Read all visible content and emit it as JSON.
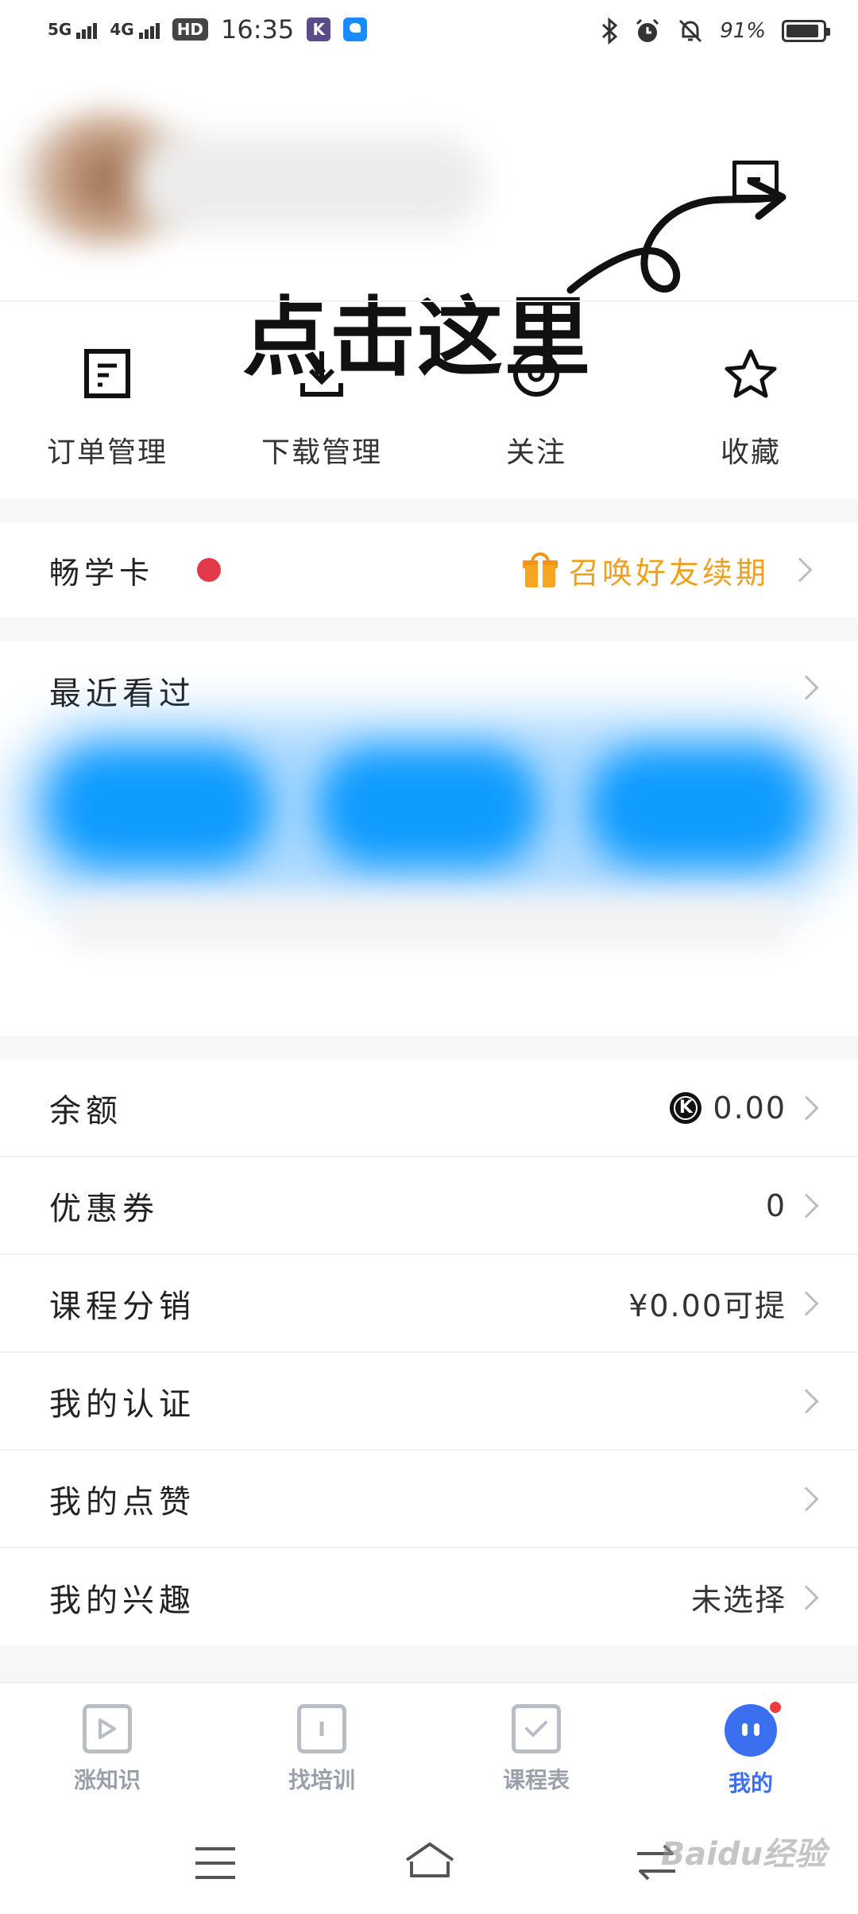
{
  "status_bar": {
    "signal1": "5G",
    "signal2": "4G",
    "hd": "HD",
    "time": "16:35",
    "app_k": "K",
    "battery_percent": "91%",
    "battery_level": 0.91
  },
  "annotation": {
    "text": "点击这里"
  },
  "quick_actions": [
    {
      "label": "订单管理",
      "icon": "order-icon"
    },
    {
      "label": "下载管理",
      "icon": "download-icon"
    },
    {
      "label": "关注",
      "icon": "follow-icon"
    },
    {
      "label": "收藏",
      "icon": "star-icon"
    }
  ],
  "card": {
    "title": "畅学卡",
    "promo": "召唤好友续期",
    "dot_color": "#e23a4a",
    "promo_color": "#f0a020"
  },
  "recent": {
    "title": "最近看过"
  },
  "list": [
    {
      "title": "余额",
      "value": "0.00",
      "coin": "K"
    },
    {
      "title": "优惠券",
      "value": "0"
    },
    {
      "title": "课程分销",
      "value": "¥0.00可提"
    },
    {
      "title": "我的认证",
      "value": ""
    },
    {
      "title": "我的点赞",
      "value": ""
    },
    {
      "title": "我的兴趣",
      "value": "未选择"
    }
  ],
  "tabs": [
    {
      "label": "涨知识",
      "icon": "play-icon"
    },
    {
      "label": "找培训",
      "icon": "book-icon"
    },
    {
      "label": "课程表",
      "icon": "checklist-icon"
    },
    {
      "label": "我的",
      "icon": "profile-face-icon",
      "active": true
    }
  ],
  "colors": {
    "accent": "#3a6ff0",
    "badge": "#f03a3a"
  },
  "watermark": "Baidu经验"
}
